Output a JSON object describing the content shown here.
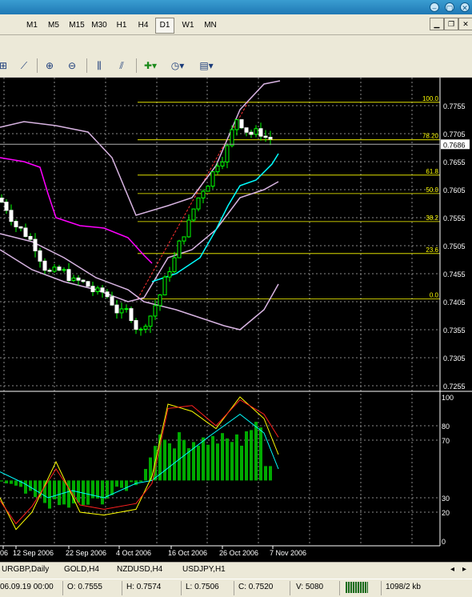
{
  "window": {
    "title_buttons": [
      "–",
      "▢",
      "✕"
    ]
  },
  "timeframes": [
    {
      "label": "M1",
      "active": false
    },
    {
      "label": "M5",
      "active": false
    },
    {
      "label": "M15",
      "active": false
    },
    {
      "label": "M30",
      "active": false
    },
    {
      "label": "H1",
      "active": false
    },
    {
      "label": "H4",
      "active": false
    },
    {
      "label": "D1",
      "active": true
    },
    {
      "label": "W1",
      "active": false
    },
    {
      "label": "MN",
      "active": false
    }
  ],
  "toolbar_icons": [
    "crosshair-icon",
    "line-chart-icon",
    "zoom-in-icon",
    "zoom-out-icon",
    "chart-shift-icon",
    "autoscroll-icon",
    "new-indicator-icon",
    "periods-icon",
    "templates-icon"
  ],
  "chart": {
    "price_axis": [
      "0.7755",
      "0.7705",
      "0.7655",
      "0.7605",
      "0.7555",
      "0.7505",
      "0.7455",
      "0.7405",
      "0.7355",
      "0.7305",
      "0.7255"
    ],
    "current_price": "0.7686",
    "fib_levels": [
      {
        "label": "100.0",
        "price": 0.7761
      },
      {
        "label": "78.20",
        "price": 0.7694
      },
      {
        "label": "61.8",
        "price": 0.7631
      },
      {
        "label": "50.0",
        "price": 0.7598
      },
      {
        "label": "38.2",
        "price": 0.7548
      },
      {
        "label": "23.6",
        "price": 0.7491
      },
      {
        "label": "0.0",
        "price": 0.741
      }
    ],
    "osc_axis": [
      "100",
      "80",
      "70",
      "30",
      "20",
      "0"
    ],
    "date_axis": [
      "06",
      "12 Sep 2006",
      "22 Sep 2006",
      "4 Oct 2006",
      "16 Oct 2006",
      "26 Oct 2006",
      "7 Nov 2006"
    ]
  },
  "tabs": [
    "URGBP,Daily",
    "GOLD,H4",
    "NZDUSD,H4",
    "USDJPY,H1"
  ],
  "status": {
    "datetime": "06.09.19 00:00",
    "open": "O: 0.7555",
    "high": "H: 0.7574",
    "low": "L: 0.7506",
    "close": "C: 0.7520",
    "volume": "V: 5080",
    "traffic": "1098/2 kb"
  },
  "colors": {
    "chart_bg": "#000000",
    "candles": "#00ff00",
    "bollinger": "#d8b4e2",
    "sar": "#00ffff",
    "ma": "#ff00ff",
    "fib": "#ffff00",
    "macd": "#00aa00"
  }
}
